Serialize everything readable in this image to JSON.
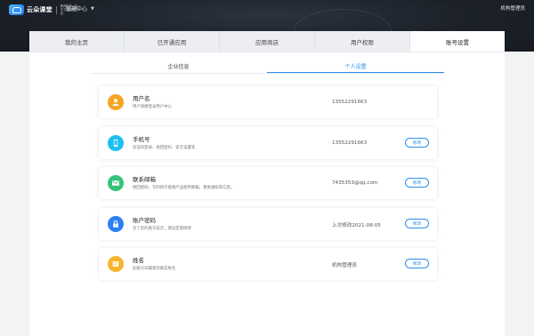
{
  "topbar": {
    "logo_name": "云朵课堂",
    "logo_sub": "教育机构一站式 在线课程平台",
    "management_center": "管理中心",
    "user": "机构管理员"
  },
  "tabs": [
    {
      "label": "我的主页"
    },
    {
      "label": "已开通应用"
    },
    {
      "label": "应用商店"
    },
    {
      "label": "用户权限"
    },
    {
      "label": "账号设置"
    }
  ],
  "subtabs": [
    {
      "label": "企业信息"
    },
    {
      "label": "个人设置"
    }
  ],
  "items": [
    {
      "icon": "user-icon",
      "title": "用户名",
      "desc": "用户快捷登录用户中心",
      "value": "13552291663",
      "button": ""
    },
    {
      "icon": "phone-icon",
      "title": "手机号",
      "desc": "验证码登录、找回密码、安全设置等",
      "value": "13552291663",
      "button": "修改"
    },
    {
      "icon": "mail-icon",
      "title": "联系邮箱",
      "desc": "找回密码，写利用于接收产品使用邮箱，重要通知等信息。",
      "value": "7435353@qq.com",
      "button": "修改"
    },
    {
      "icon": "lock-icon",
      "title": "账户密码",
      "desc": "为了您的账号安全，建议定期修改",
      "value": "上次修改2021-08-05",
      "button": "修改"
    },
    {
      "icon": "signature-icon",
      "title": "姓名",
      "desc": "此账号归属者的真实姓名",
      "value": "机构管理员",
      "button": "修改"
    }
  ],
  "colors": {
    "accent": "#2a8cf0",
    "topbar": "#1c2129"
  }
}
